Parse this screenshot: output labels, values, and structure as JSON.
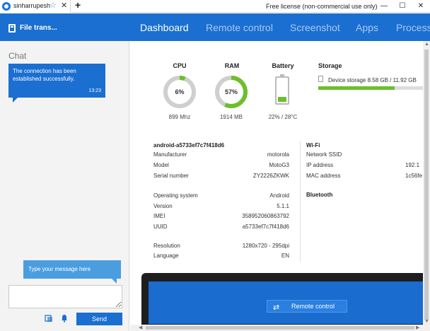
{
  "browser": {
    "tab_label": "sinharrupesh",
    "license_text": "Free license (non-commercial use only)"
  },
  "app": {
    "title": "File trans..."
  },
  "nav": [
    {
      "label": "Dashboard",
      "active": true
    },
    {
      "label": "Remote control",
      "active": false
    },
    {
      "label": "Screenshot",
      "active": false
    },
    {
      "label": "Apps",
      "active": false
    },
    {
      "label": "Process",
      "active": false
    }
  ],
  "chat": {
    "title": "Chat",
    "bubble_text": "The connection has been established successfully.",
    "bubble_time": "13:23",
    "input_hint": "Type your message here",
    "send_label": "Send"
  },
  "metrics": {
    "cpu": {
      "label": "CPU",
      "value": "6%",
      "percent": 6,
      "sub": "899 Mhz"
    },
    "ram": {
      "label": "RAM",
      "value": "57%",
      "percent": 57,
      "sub": "1914 MB"
    },
    "battery": {
      "label": "Battery",
      "percent": 22,
      "sub": "22% / 28°C"
    },
    "storage": {
      "label": "Storage",
      "text": "Device storage 8.58 GB / 11.92 GB",
      "used_percent": 72
    }
  },
  "device": {
    "name": "android-a5733ef7c7f418d6",
    "rows": [
      {
        "label": "Manufacturer",
        "value": "motorola"
      },
      {
        "label": "Model",
        "value": "MotoG3"
      },
      {
        "label": "Serial number",
        "value": "ZY2226ZKWK"
      },
      {
        "label": "Operating system",
        "value": "Android"
      },
      {
        "label": "Version",
        "value": "5.1.1"
      },
      {
        "label": "IMEI",
        "value": "358952060863792"
      },
      {
        "label": "UUID",
        "value": "a5733ef7c7f418d6"
      },
      {
        "label": "Resolution",
        "value": "1280x720 - 295dpi"
      },
      {
        "label": "Language",
        "value": "EN"
      }
    ]
  },
  "wifi": {
    "title": "Wi-Fi",
    "rows": [
      {
        "label": "Network SSID",
        "value": ""
      },
      {
        "label": "IP address",
        "value": "192.1"
      },
      {
        "label": "MAC address",
        "value": "1c56fe"
      }
    ]
  },
  "bluetooth": {
    "title": "Bluetooth"
  },
  "remote_button": {
    "label": "Remote control"
  },
  "colors": {
    "brand_blue": "#1b6fd0",
    "gauge_green": "#6cbf2a",
    "gauge_track": "#cfcfcf"
  }
}
